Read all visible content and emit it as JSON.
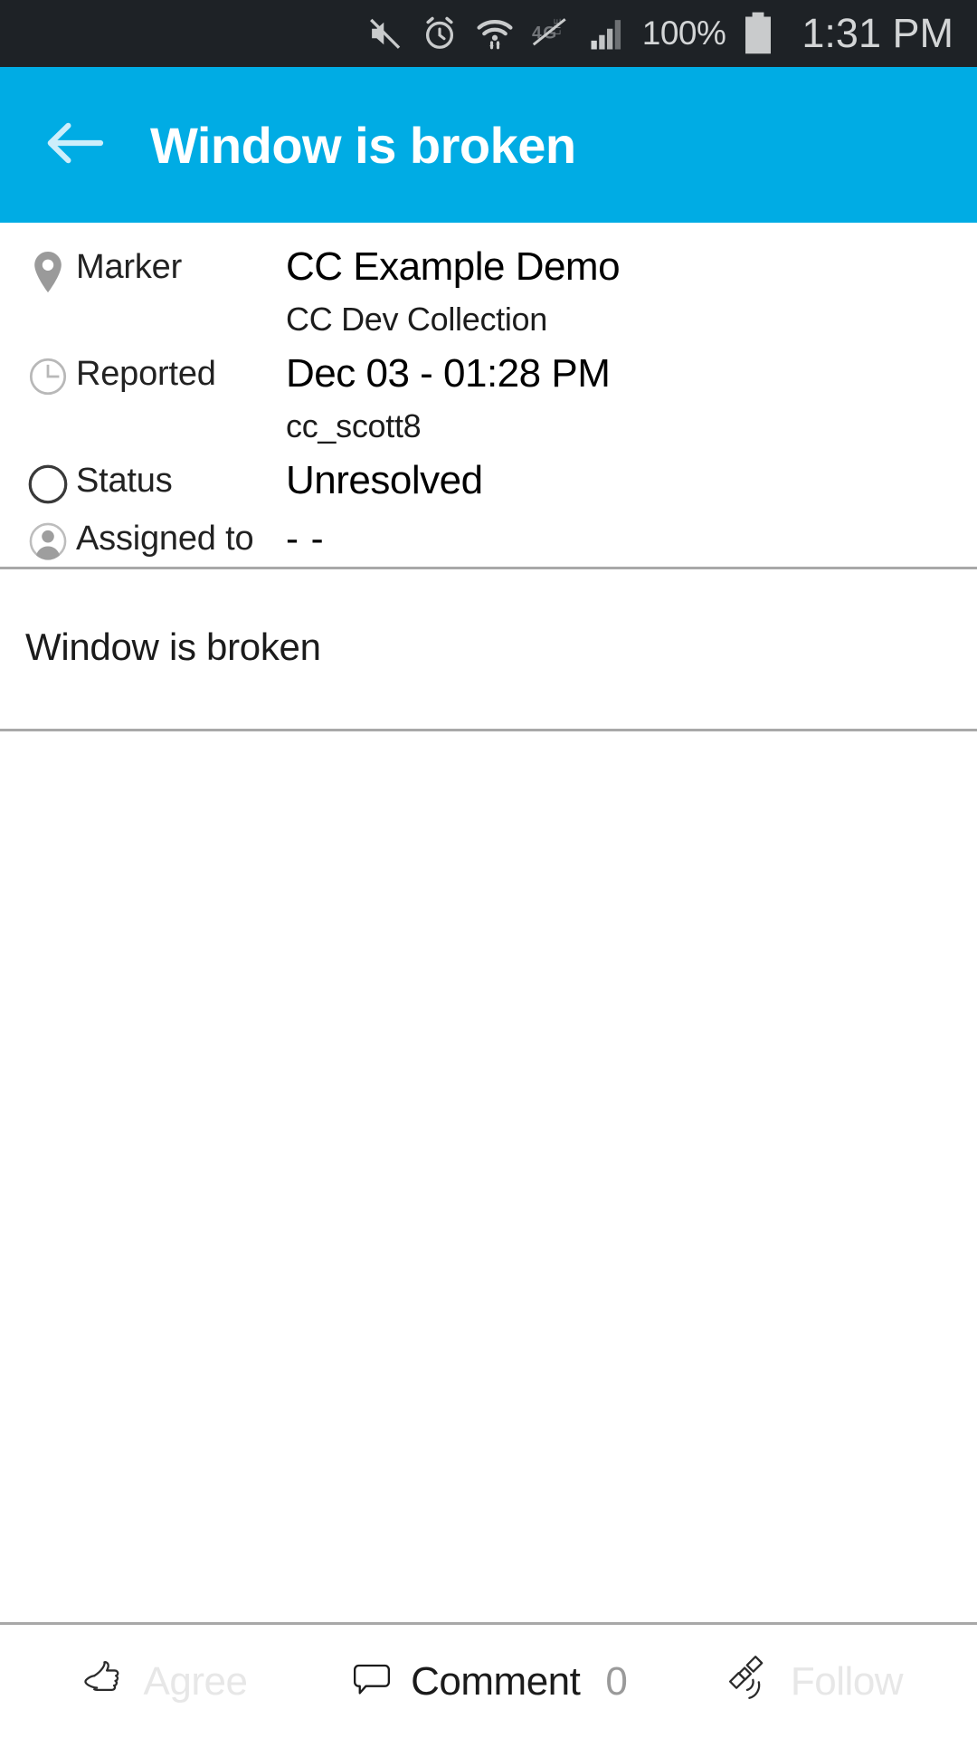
{
  "status_bar": {
    "icons": [
      "mute-icon",
      "alarm-icon",
      "wifi-icon",
      "mobile-data-off-icon",
      "signal-icon"
    ],
    "battery_percent": "100%",
    "battery_icon": "battery-full-icon",
    "time": "1:31 PM"
  },
  "app_bar": {
    "back_icon": "back-arrow-icon",
    "title": "Window is broken",
    "background_color": "#00ace4",
    "title_color": "#ffffff"
  },
  "details": {
    "rows": [
      {
        "icon": "map-pin-icon",
        "label": "Marker",
        "value": "CC Example Demo",
        "subvalue": "CC Dev Collection"
      },
      {
        "icon": "clock-icon",
        "label": "Reported",
        "value": "Dec 03 - 01:28 PM",
        "subvalue": "cc_scott8"
      },
      {
        "icon": "status-circle-icon",
        "label": "Status",
        "value": "Unresolved",
        "subvalue": ""
      },
      {
        "icon": "person-avatar-icon",
        "label": "Assigned to",
        "value": "- -",
        "subvalue": ""
      }
    ]
  },
  "description": {
    "text": "Window is broken"
  },
  "action_bar": {
    "agree": {
      "icon": "thumbs-up-icon",
      "label": "Agree",
      "state": "disabled"
    },
    "comment": {
      "icon": "comment-bubble-icon",
      "label": "Comment",
      "count": "0",
      "state": "active"
    },
    "follow": {
      "icon": "satellite-broadcast-icon",
      "label": "Follow",
      "state": "disabled"
    }
  },
  "colors": {
    "accent": "#00ace4",
    "status_bar_bg": "#1e2226",
    "divider": "#a8a8a8",
    "muted_text": "#e7e7e7",
    "count_text": "#9a9a9a"
  }
}
